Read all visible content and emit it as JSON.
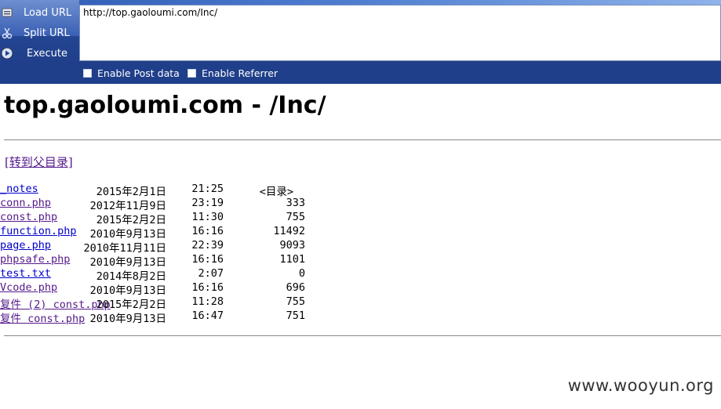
{
  "toolbar": {
    "menu": [
      {
        "label": "Load URL",
        "icon": "load-url-icon"
      },
      {
        "label": "Split URL",
        "icon": "scissors-icon"
      },
      {
        "label": "Execute",
        "icon": "execute-play-icon"
      }
    ],
    "url_value": "http://top.gaoloumi.com/Inc/",
    "options": [
      {
        "label": "Enable Post data",
        "checked": false
      },
      {
        "label": "Enable Referrer",
        "checked": false
      }
    ],
    "colors": {
      "bar": "#1f3f8a",
      "text": "#ffffff"
    }
  },
  "page": {
    "title": "top.gaoloumi.com - /Inc/",
    "parent_link": "[转到父目录]",
    "entries": [
      {
        "date": "2015年2月1日",
        "time": "21:25",
        "size": "<目录>",
        "name": "_notes",
        "type": "dir"
      },
      {
        "date": "2012年11月9日",
        "time": "23:19",
        "size": "333",
        "name": "conn.php",
        "type": "file"
      },
      {
        "date": "2015年2月2日",
        "time": "11:30",
        "size": "755",
        "name": "const.php",
        "type": "file"
      },
      {
        "date": "2010年9月13日",
        "time": "16:16",
        "size": "11492",
        "name": "function.php",
        "type": "file"
      },
      {
        "date": "2010年11月11日",
        "time": "22:39",
        "size": "9093",
        "name": "page.php",
        "type": "file"
      },
      {
        "date": "2010年9月13日",
        "time": "16:16",
        "size": "1101",
        "name": "phpsafe.php",
        "type": "file"
      },
      {
        "date": "2014年8月2日",
        "time": "2:07",
        "size": "0",
        "name": "test.txt",
        "type": "file"
      },
      {
        "date": "2010年9月13日",
        "time": "16:16",
        "size": "696",
        "name": "Vcode.php",
        "type": "file"
      },
      {
        "date": "2015年2月2日",
        "time": "11:28",
        "size": "755",
        "name": "复件 (2) const.php",
        "type": "file"
      },
      {
        "date": "2010年9月13日",
        "time": "16:47",
        "size": "751",
        "name": "复件 const.php",
        "type": "file"
      }
    ],
    "link_colors": {
      "visited": "#551a8b",
      "unvisited": "#0000cc"
    }
  },
  "watermark": "www.wooyun.org"
}
